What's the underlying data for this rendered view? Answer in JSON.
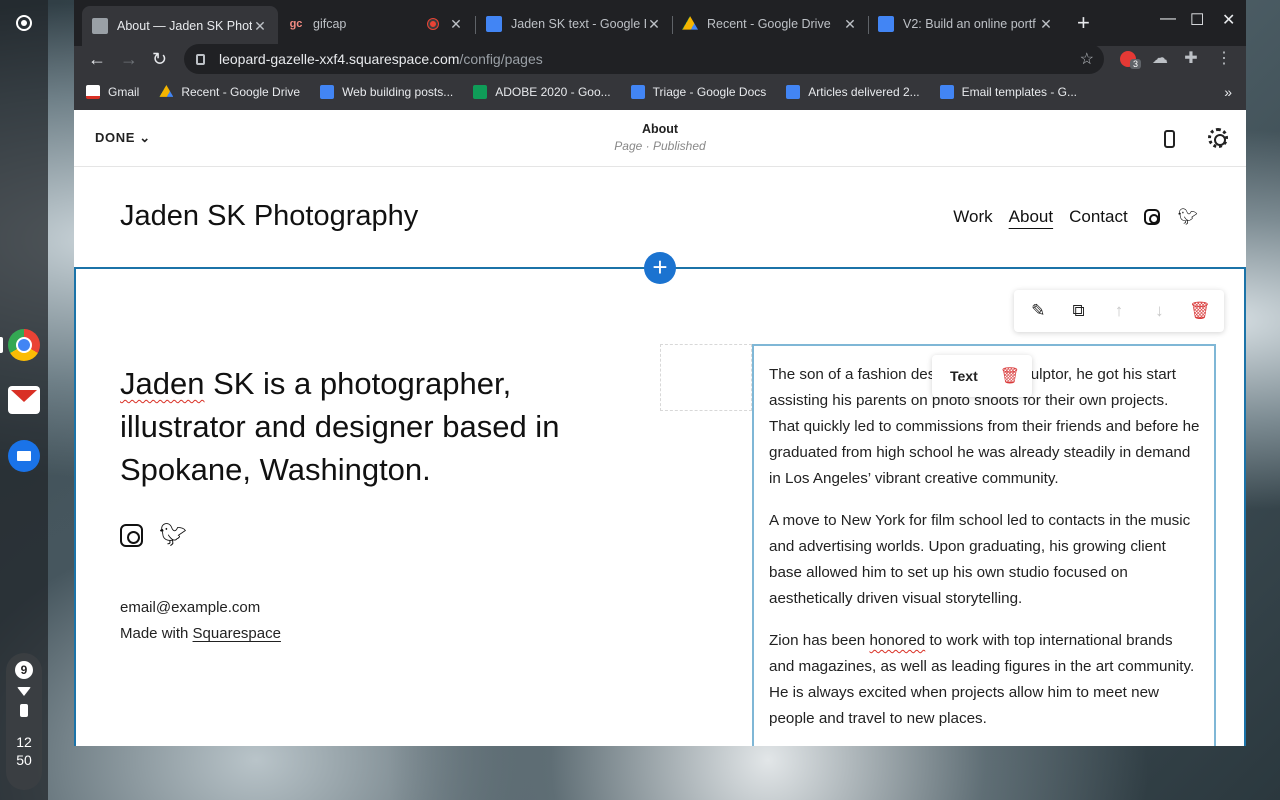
{
  "browser": {
    "tabs": [
      {
        "title": "About — Jaden SK Photo",
        "active": true
      },
      {
        "title": "gifcap",
        "active": false
      },
      {
        "title": "Jaden SK text - Google D",
        "active": false
      },
      {
        "title": "Recent - Google Drive",
        "active": false
      },
      {
        "title": "V2: Build an online portf",
        "active": false
      }
    ],
    "url_host": "leopard-gazelle-xxf4.squarespace.com",
    "url_path": "/config/pages",
    "extension_badge": "3",
    "bookmarks": [
      {
        "label": "Gmail",
        "icon": "gmail-icon"
      },
      {
        "label": "Recent - Google Drive",
        "icon": "drive-icon"
      },
      {
        "label": "Web building posts...",
        "icon": "doc-icon"
      },
      {
        "label": "ADOBE 2020 - Goo...",
        "icon": "sheet-icon"
      },
      {
        "label": "Triage - Google Docs",
        "icon": "doc-icon"
      },
      {
        "label": "Articles delivered 2...",
        "icon": "doc-icon"
      },
      {
        "label": "Email templates - G...",
        "icon": "doc-icon"
      }
    ]
  },
  "editor": {
    "done_label": "DONE",
    "page_title": "About",
    "page_status": "Page · Published"
  },
  "site": {
    "title": "Jaden SK Photography",
    "nav": [
      "Work",
      "About",
      "Contact"
    ],
    "headline_first": "Jaden",
    "headline_rest": " SK is a photographer, illustrator and designer based in Spokane, Washington.",
    "email": "email@example.com",
    "made_with_prefix": "Made with ",
    "made_with_link": "Squarespace",
    "text_block": {
      "chip_label": "Text",
      "p1": "The son of a fashion designer and a sculptor, he got his start assisting his parents on photo shoots for their own projects. That quickly led to commissions from their friends and before he graduated from high school he was already steadily in demand in Los Angeles’ vibrant creative community.",
      "p2": "A move to New York for film school led to contacts in the music and advertising worlds. Upon graduating, his growing client base allowed him to set up his own studio focused on aesthetically driven visual storytelling.",
      "p3_a": "Zion has been ",
      "p3_b": "honored",
      "p3_c": " to work with top international brands and magazines, as well as leading figures in the art community. He is always excited when projects allow him to meet new people and travel to new places."
    }
  },
  "system": {
    "notification_count": "9",
    "time_hour": "12",
    "time_min": "50"
  },
  "colors": {
    "accent_blue": "#1b73d0",
    "section_outline": "#1b73a8",
    "delete_red": "#d93b3b"
  }
}
